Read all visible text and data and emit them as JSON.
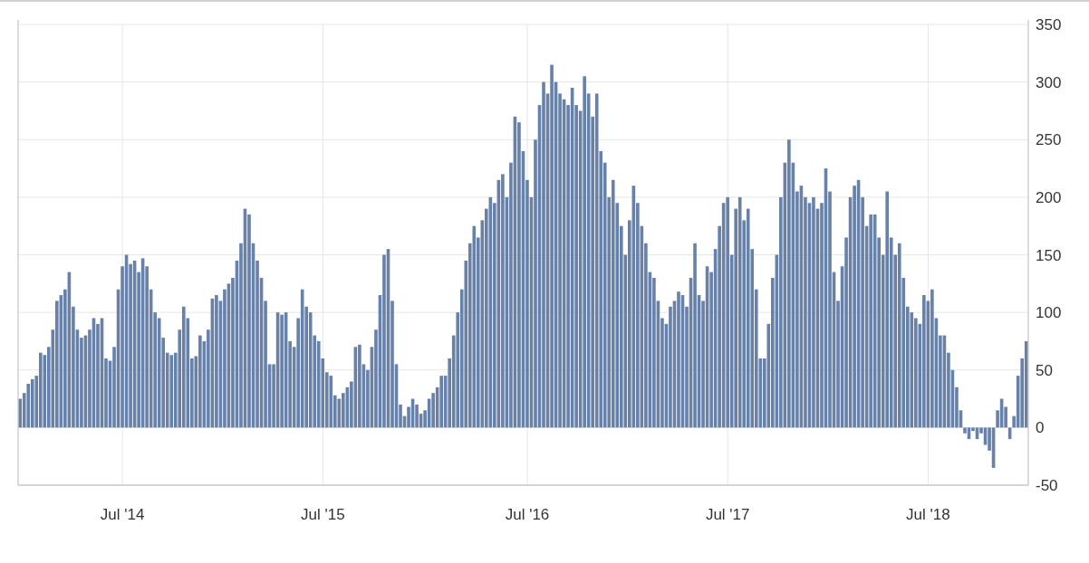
{
  "chart_data": {
    "type": "bar",
    "orientation": "vertical",
    "grid": true,
    "categories": [
      null,
      null,
      null,
      null,
      null,
      null,
      null,
      null,
      null,
      null,
      null,
      null,
      null,
      null,
      null,
      null,
      null,
      null,
      null,
      null,
      null,
      null,
      null,
      null,
      null,
      "Jul '14",
      null,
      null,
      null,
      null,
      null,
      null,
      null,
      null,
      null,
      null,
      null,
      null,
      null,
      null,
      null,
      null,
      null,
      null,
      null,
      null,
      null,
      null,
      null,
      null,
      null,
      null,
      null,
      null,
      null,
      null,
      null,
      null,
      null,
      null,
      null,
      null,
      null,
      null,
      null,
      null,
      null,
      null,
      null,
      null,
      null,
      null,
      null,
      null,
      "Jul '15",
      null,
      null,
      null,
      null,
      null,
      null,
      null,
      null,
      null,
      null,
      null,
      null,
      null,
      null,
      null,
      null,
      null,
      null,
      null,
      null,
      null,
      null,
      null,
      null,
      null,
      null,
      null,
      null,
      null,
      null,
      null,
      null,
      null,
      null,
      null,
      null,
      null,
      null,
      null,
      null,
      null,
      null,
      null,
      null,
      null,
      null,
      null,
      null,
      null,
      "Jul '16",
      null,
      null,
      null,
      null,
      null,
      null,
      null,
      null,
      null,
      null,
      null,
      null,
      null,
      null,
      null,
      null,
      null,
      null,
      null,
      null,
      null,
      null,
      null,
      null,
      null,
      null,
      null,
      null,
      null,
      null,
      null,
      null,
      null,
      null,
      null,
      null,
      null,
      null,
      null,
      null,
      null,
      null,
      null,
      null,
      null,
      null,
      null,
      null,
      "Jul '17",
      null,
      null,
      null,
      null,
      null,
      null,
      null,
      null,
      null,
      null,
      null,
      null,
      null,
      null,
      null,
      null,
      null,
      null,
      null,
      null,
      null,
      null,
      null,
      null,
      null,
      null,
      null,
      null,
      null,
      null,
      null,
      null,
      null,
      null,
      null,
      null,
      null,
      null,
      null,
      null,
      null,
      null,
      null,
      null,
      null,
      null,
      null,
      null,
      "Jul '18",
      null,
      null,
      null,
      null,
      null,
      null,
      null,
      null,
      null,
      null,
      null,
      null,
      null,
      null,
      null,
      null,
      null,
      null,
      null,
      null,
      null,
      null,
      null,
      null
    ],
    "values": [
      25,
      30,
      38,
      42,
      45,
      65,
      63,
      70,
      85,
      110,
      115,
      120,
      135,
      105,
      85,
      78,
      80,
      85,
      95,
      90,
      95,
      60,
      58,
      70,
      120,
      140,
      150,
      142,
      145,
      135,
      147,
      140,
      120,
      100,
      95,
      78,
      65,
      63,
      65,
      85,
      105,
      95,
      60,
      62,
      80,
      75,
      85,
      112,
      115,
      110,
      120,
      125,
      130,
      145,
      160,
      190,
      185,
      160,
      145,
      130,
      110,
      55,
      55,
      100,
      98,
      100,
      75,
      70,
      95,
      120,
      105,
      100,
      80,
      75,
      60,
      48,
      45,
      28,
      25,
      30,
      35,
      40,
      70,
      72,
      55,
      50,
      70,
      85,
      115,
      150,
      155,
      110,
      55,
      20,
      10,
      18,
      25,
      20,
      12,
      15,
      25,
      30,
      35,
      45,
      45,
      60,
      80,
      100,
      120,
      145,
      160,
      175,
      165,
      180,
      190,
      200,
      195,
      215,
      220,
      200,
      230,
      270,
      265,
      240,
      215,
      200,
      250,
      280,
      300,
      290,
      315,
      300,
      290,
      285,
      280,
      295,
      280,
      275,
      305,
      290,
      270,
      290,
      240,
      230,
      200,
      215,
      195,
      175,
      150,
      180,
      210,
      195,
      175,
      160,
      135,
      130,
      110,
      95,
      90,
      105,
      110,
      118,
      115,
      105,
      130,
      160,
      115,
      110,
      140,
      135,
      155,
      175,
      195,
      200,
      150,
      190,
      200,
      180,
      190,
      155,
      120,
      60,
      60,
      90,
      130,
      150,
      200,
      230,
      250,
      230,
      205,
      210,
      200,
      195,
      200,
      190,
      195,
      225,
      205,
      135,
      110,
      140,
      165,
      200,
      210,
      215,
      200,
      175,
      185,
      185,
      165,
      150,
      205,
      165,
      150,
      160,
      130,
      105,
      100,
      95,
      90,
      115,
      110,
      120,
      95,
      80,
      80,
      65,
      50,
      35,
      15,
      -5,
      -10,
      -3,
      -10,
      -5,
      -15,
      -20,
      -35,
      15,
      25,
      18,
      -10,
      10,
      45,
      60,
      75
    ],
    "ylim": [
      -50,
      350
    ],
    "yticks": [
      -50,
      0,
      50,
      100,
      150,
      200,
      250,
      300,
      350
    ]
  }
}
